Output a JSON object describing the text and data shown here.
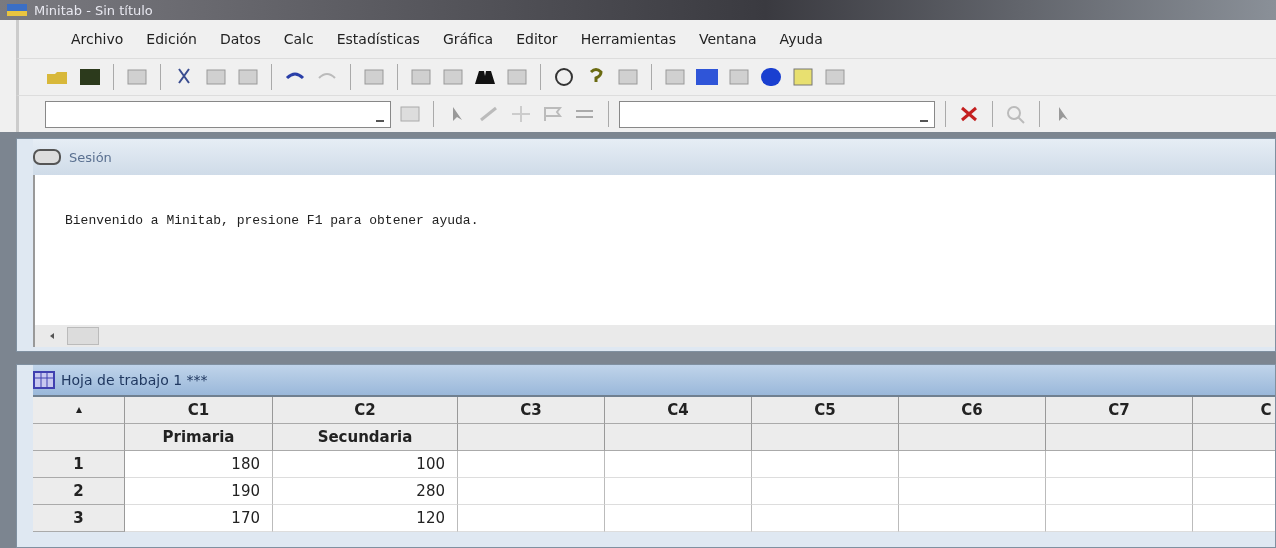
{
  "window": {
    "title": "Minitab - Sin título"
  },
  "menu": [
    "Archivo",
    "Edición",
    "Datos",
    "Calc",
    "Estadísticas",
    "Gráfica",
    "Editor",
    "Herramientas",
    "Ventana",
    "Ayuda"
  ],
  "session": {
    "title": "Sesión",
    "message": "Bienvenido a Minitab, presione F1 para obtener ayuda."
  },
  "worksheet": {
    "title": "Hoja de trabajo 1 ***",
    "columns": [
      {
        "id": "C1",
        "name": "Primaria"
      },
      {
        "id": "C2",
        "name": "Secundaria"
      },
      {
        "id": "C3"
      },
      {
        "id": "C4"
      },
      {
        "id": "C5"
      },
      {
        "id": "C6"
      },
      {
        "id": "C7"
      },
      {
        "id": "C"
      }
    ],
    "rows": [
      {
        "number": "1",
        "cells": [
          "180",
          "100"
        ]
      },
      {
        "number": "2",
        "cells": [
          "190",
          "280"
        ]
      },
      {
        "number": "3",
        "cells": [
          "170",
          "120"
        ]
      }
    ]
  }
}
